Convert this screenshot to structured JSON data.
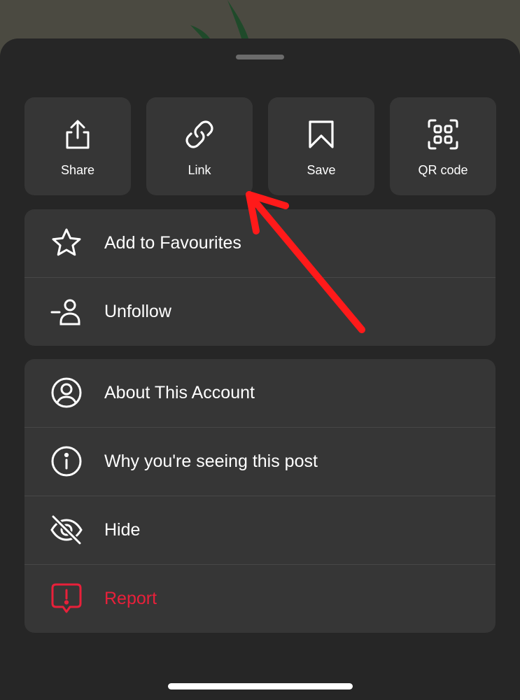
{
  "actions": [
    {
      "key": "share",
      "label": "Share",
      "icon": "share-icon"
    },
    {
      "key": "link",
      "label": "Link",
      "icon": "link-icon"
    },
    {
      "key": "save",
      "label": "Save",
      "icon": "bookmark-icon"
    },
    {
      "key": "qr",
      "label": "QR code",
      "icon": "qr-code-icon"
    }
  ],
  "group1": [
    {
      "label": "Add to Favourites",
      "icon": "star-icon"
    },
    {
      "label": "Unfollow",
      "icon": "unfollow-icon"
    }
  ],
  "group2": [
    {
      "label": "About This Account",
      "icon": "account-icon"
    },
    {
      "label": "Why you're seeing this post",
      "icon": "info-icon"
    },
    {
      "label": "Hide",
      "icon": "eye-off-icon"
    },
    {
      "label": "Report",
      "icon": "report-icon"
    }
  ],
  "colors": {
    "sheet": "#262626",
    "tile": "#363636",
    "text": "#ffffff",
    "danger": "#e8203a",
    "annotation_arrow": "#ff1a1a"
  }
}
